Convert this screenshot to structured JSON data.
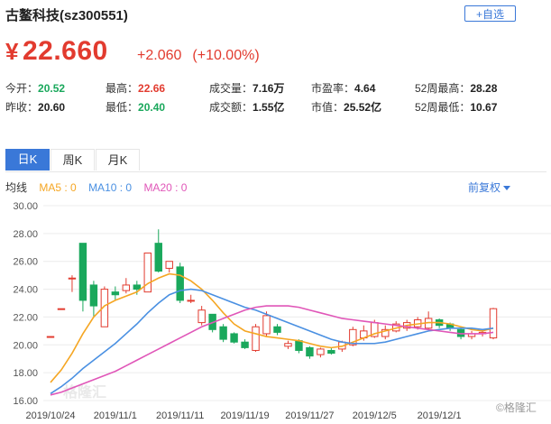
{
  "stock": {
    "title": "古鳌科技(sz300551)",
    "add_button": "+自选"
  },
  "quote": {
    "currency": "¥",
    "price": "22.660",
    "change": "+2.060",
    "change_pct": "(+10.00%)"
  },
  "stats": [
    {
      "label": "今开：",
      "value": "20.52",
      "color": "green"
    },
    {
      "label": "最高：",
      "value": "22.66",
      "color": "red"
    },
    {
      "label": "成交量：",
      "value": "7.16万",
      "color": "dark"
    },
    {
      "label": "市盈率：",
      "value": "4.64",
      "color": "dark"
    },
    {
      "label": "52周最高：",
      "value": "28.28",
      "color": "dark"
    },
    {
      "label": "昨收：",
      "value": "20.60",
      "color": "dark"
    },
    {
      "label": "最低：",
      "value": "20.40",
      "color": "green"
    },
    {
      "label": "成交额：",
      "value": "1.55亿",
      "color": "dark"
    },
    {
      "label": "市值：",
      "value": "25.52亿",
      "color": "dark"
    },
    {
      "label": "52周最低：",
      "value": "10.67",
      "color": "dark"
    }
  ],
  "tabs": [
    {
      "label": "日K",
      "active": true
    },
    {
      "label": "周K",
      "active": false
    },
    {
      "label": "月K",
      "active": false
    }
  ],
  "legend": {
    "label": "均线",
    "ma5": "MA5 : 0",
    "ma10": "MA10 : 0",
    "ma20": "MA20 : 0",
    "adjust": "前复权"
  },
  "colors": {
    "up": "#e23b2f",
    "down": "#1aa85c",
    "ma5": "#f5a623",
    "ma10": "#4a90e2",
    "ma20": "#e056b8",
    "accent": "#3a78d8"
  },
  "chart_data": {
    "type": "candlestick",
    "yticks": [
      "30.00",
      "28.00",
      "26.00",
      "24.00",
      "22.00",
      "20.00",
      "18.00",
      "16.00"
    ],
    "ylim": [
      16,
      30
    ],
    "xticks": [
      {
        "label": "2019/10/24",
        "index": 0
      },
      {
        "label": "2019/11/1",
        "index": 6
      },
      {
        "label": "2019/11/11",
        "index": 12
      },
      {
        "label": "2019/11/19",
        "index": 18
      },
      {
        "label": "2019/11/27",
        "index": 24
      },
      {
        "label": "2019/12/5",
        "index": 30
      },
      {
        "label": "2019/12/1",
        "index": 36
      }
    ],
    "watermark": "格隆汇",
    "candles": [
      {
        "o": 20.6,
        "c": 20.6,
        "h": 20.6,
        "l": 20.6
      },
      {
        "o": 22.6,
        "c": 22.6,
        "h": 22.6,
        "l": 22.6
      },
      {
        "o": 24.8,
        "c": 24.8,
        "h": 25.0,
        "l": 23.8
      },
      {
        "o": 27.3,
        "c": 23.2,
        "h": 27.3,
        "l": 22.4
      },
      {
        "o": 24.3,
        "c": 22.8,
        "h": 24.6,
        "l": 22.0
      },
      {
        "o": 21.3,
        "c": 24.0,
        "h": 24.2,
        "l": 21.3
      },
      {
        "o": 23.8,
        "c": 23.6,
        "h": 24.2,
        "l": 23.2
      },
      {
        "o": 23.9,
        "c": 24.3,
        "h": 24.8,
        "l": 23.7
      },
      {
        "o": 24.3,
        "c": 24.0,
        "h": 24.6,
        "l": 23.6
      },
      {
        "o": 23.8,
        "c": 26.6,
        "h": 26.6,
        "l": 23.8
      },
      {
        "o": 27.3,
        "c": 25.3,
        "h": 28.3,
        "l": 25.2
      },
      {
        "o": 25.5,
        "c": 26.0,
        "h": 26.0,
        "l": 25.2
      },
      {
        "o": 25.6,
        "c": 23.2,
        "h": 25.9,
        "l": 23.0
      },
      {
        "o": 23.2,
        "c": 23.2,
        "h": 23.6,
        "l": 23.0
      },
      {
        "o": 21.6,
        "c": 22.5,
        "h": 22.8,
        "l": 21.4
      },
      {
        "o": 22.2,
        "c": 21.1,
        "h": 22.2,
        "l": 20.9
      },
      {
        "o": 21.3,
        "c": 20.4,
        "h": 21.5,
        "l": 20.2
      },
      {
        "o": 20.8,
        "c": 20.2,
        "h": 20.9,
        "l": 20.1
      },
      {
        "o": 20.2,
        "c": 19.8,
        "h": 20.4,
        "l": 19.7
      },
      {
        "o": 19.6,
        "c": 21.3,
        "h": 21.5,
        "l": 19.5
      },
      {
        "o": 20.8,
        "c": 22.1,
        "h": 22.4,
        "l": 20.6
      },
      {
        "o": 21.3,
        "c": 20.9,
        "h": 21.5,
        "l": 20.7
      },
      {
        "o": 19.9,
        "c": 20.1,
        "h": 20.3,
        "l": 19.7
      },
      {
        "o": 20.3,
        "c": 19.6,
        "h": 20.4,
        "l": 19.4
      },
      {
        "o": 19.8,
        "c": 19.2,
        "h": 19.9,
        "l": 19.0
      },
      {
        "o": 19.3,
        "c": 19.7,
        "h": 19.8,
        "l": 19.1
      },
      {
        "o": 19.6,
        "c": 19.4,
        "h": 19.8,
        "l": 19.3
      },
      {
        "o": 19.7,
        "c": 20.2,
        "h": 20.3,
        "l": 19.5
      },
      {
        "o": 20.0,
        "c": 21.1,
        "h": 21.3,
        "l": 19.9
      },
      {
        "o": 20.5,
        "c": 21.0,
        "h": 21.4,
        "l": 20.3
      },
      {
        "o": 20.6,
        "c": 21.6,
        "h": 21.8,
        "l": 20.5
      },
      {
        "o": 20.6,
        "c": 21.1,
        "h": 21.4,
        "l": 20.4
      },
      {
        "o": 21.0,
        "c": 21.5,
        "h": 21.7,
        "l": 20.9
      },
      {
        "o": 21.2,
        "c": 21.6,
        "h": 21.8,
        "l": 21.0
      },
      {
        "o": 21.3,
        "c": 21.8,
        "h": 22.0,
        "l": 21.1
      },
      {
        "o": 21.2,
        "c": 21.9,
        "h": 22.4,
        "l": 21.1
      },
      {
        "o": 21.8,
        "c": 21.4,
        "h": 21.9,
        "l": 21.2
      },
      {
        "o": 21.5,
        "c": 21.2,
        "h": 21.6,
        "l": 21.0
      },
      {
        "o": 21.1,
        "c": 20.6,
        "h": 21.2,
        "l": 20.4
      },
      {
        "o": 20.6,
        "c": 20.8,
        "h": 21.0,
        "l": 20.4
      },
      {
        "o": 20.8,
        "c": 20.9,
        "h": 21.0,
        "l": 20.6
      },
      {
        "o": 20.5,
        "c": 22.6,
        "h": 22.66,
        "l": 20.4
      }
    ],
    "ma5": [
      17.3,
      18.2,
      19.4,
      20.8,
      22.0,
      22.8,
      23.2,
      23.5,
      23.8,
      24.4,
      24.8,
      25.1,
      25.0,
      24.6,
      24.0,
      23.2,
      22.3,
      21.5,
      21.0,
      20.8,
      20.6,
      20.5,
      20.4,
      20.3,
      20.1,
      19.9,
      19.8,
      19.9,
      20.2,
      20.5,
      20.8,
      21.0,
      21.2,
      21.4,
      21.5,
      21.6,
      21.6,
      21.5,
      21.3,
      21.1,
      21.0,
      21.2
    ],
    "ma10": [
      16.5,
      17.0,
      17.6,
      18.3,
      18.9,
      19.5,
      20.1,
      20.8,
      21.5,
      22.3,
      23.0,
      23.6,
      23.9,
      24.0,
      23.9,
      23.6,
      23.3,
      23.0,
      22.7,
      22.5,
      22.2,
      21.9,
      21.6,
      21.3,
      21.0,
      20.7,
      20.4,
      20.2,
      20.1,
      20.1,
      20.1,
      20.2,
      20.4,
      20.6,
      20.8,
      21.0,
      21.1,
      21.2,
      21.2,
      21.2,
      21.1,
      21.2
    ],
    "ma20": [
      16.4,
      16.6,
      16.9,
      17.2,
      17.5,
      17.8,
      18.1,
      18.5,
      18.9,
      19.3,
      19.7,
      20.1,
      20.5,
      20.9,
      21.3,
      21.6,
      21.9,
      22.2,
      22.5,
      22.7,
      22.8,
      22.8,
      22.8,
      22.7,
      22.5,
      22.3,
      22.1,
      21.9,
      21.8,
      21.7,
      21.6,
      21.5,
      21.4,
      21.3,
      21.2,
      21.1,
      21.0,
      20.9,
      20.8,
      20.8,
      20.8,
      20.9
    ]
  }
}
